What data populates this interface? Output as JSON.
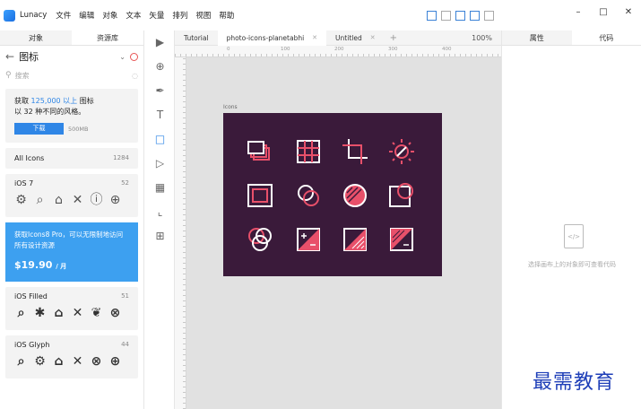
{
  "app": {
    "name": "Lunacy"
  },
  "menu": [
    "文件",
    "编辑",
    "对象",
    "文本",
    "矢量",
    "排列",
    "视图",
    "帮助"
  ],
  "window_controls": {
    "minimize": "–",
    "maximize": "□",
    "close": "✕"
  },
  "left_panel": {
    "tabs": [
      "对象",
      "资源库"
    ],
    "active_tab": "资源库",
    "category": "图标",
    "search_placeholder": "搜索",
    "promo": {
      "line1_prefix": "获取",
      "line1_highlight": "125,000 以上",
      "line1_suffix": "图标",
      "line2": "以 32 种不同的风格。",
      "download_label": "下载",
      "size": "500MB"
    },
    "all_icons": {
      "label": "All Icons",
      "count": "1284"
    },
    "sets": [
      {
        "name": "iOS 7",
        "count": "52",
        "icons": [
          "⚙",
          "⌕",
          "⌂",
          "✕",
          "ⓘ",
          "⊕"
        ]
      },
      {
        "name": "iOS Filled",
        "count": "51",
        "icons": [
          "⌕",
          "✱",
          "⌂",
          "✕",
          "❦",
          "⊗"
        ]
      },
      {
        "name": "iOS Glyph",
        "count": "44",
        "icons": [
          "⌕",
          "⚙",
          "⌂",
          "✕",
          "⊗",
          "⊕"
        ]
      }
    ],
    "pro": {
      "text": "获取Icons8 Pro，可以无限制地访问所有设计资源",
      "price": "$19.90",
      "per": "/ 月"
    }
  },
  "doc_tabs": [
    {
      "label": "Tutorial",
      "active": false
    },
    {
      "label": "photo-icons-planetabhi",
      "active": true
    },
    {
      "label": "Untitled",
      "active": false
    }
  ],
  "zoom": "100%",
  "canvas": {
    "frame_label": "Icons",
    "ruler_labels": [
      "0",
      "100",
      "200",
      "300",
      "400"
    ]
  },
  "right_panel": {
    "tabs": [
      "属性",
      "代码"
    ],
    "active_tab": "代码",
    "empty_hint": "选择画布上的对象即可查看代码"
  },
  "colors": {
    "accent": "#2f86e6",
    "frame_bg": "#3a1a3a",
    "icon_red": "#e8506a",
    "icon_white": "#ffffff",
    "pro_bg": "#3da0f0"
  },
  "watermark": "最需教育"
}
